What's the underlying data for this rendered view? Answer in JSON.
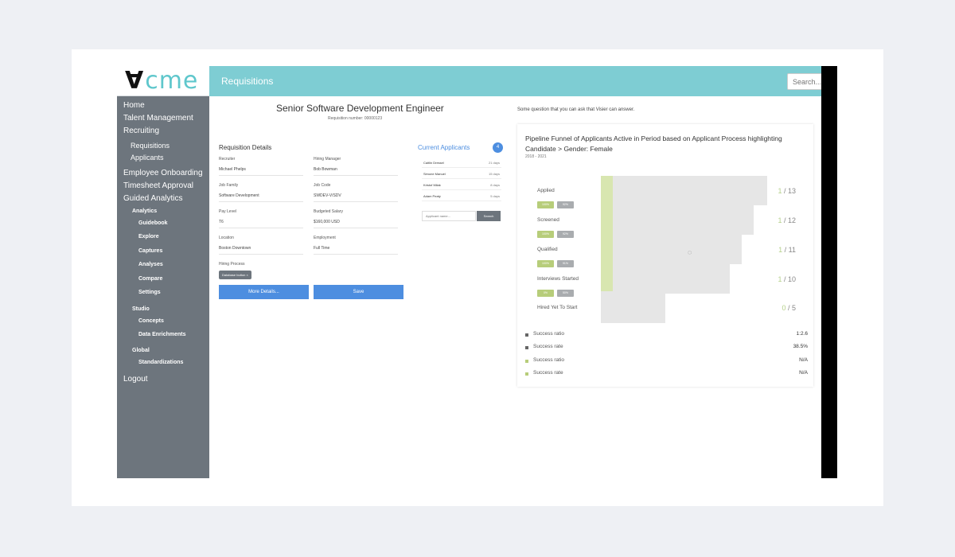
{
  "app": {
    "logo": {
      "mark": "∀",
      "text": "cme"
    },
    "header": {
      "title": "Requisitions",
      "search_placeholder": "Search..."
    }
  },
  "sidebar": {
    "items": [
      {
        "label": "Home",
        "level": 0
      },
      {
        "label": "Talent Management",
        "level": 0
      },
      {
        "label": "Recruiting",
        "level": 0
      },
      {
        "label": "Requisitions",
        "level": 1
      },
      {
        "label": "Applicants",
        "level": 1
      },
      {
        "label": "Employee Onboarding",
        "level": 0
      },
      {
        "label": "Timesheet Approval",
        "level": 0
      },
      {
        "label": "Guided Analytics",
        "level": 0
      },
      {
        "label": "Analytics",
        "level": 2
      },
      {
        "label": "Guidebook",
        "level": 3
      },
      {
        "label": "Explore",
        "level": 3
      },
      {
        "label": "Captures",
        "level": 3
      },
      {
        "label": "Analyses",
        "level": 3
      },
      {
        "label": "Compare",
        "level": 3
      },
      {
        "label": "Settings",
        "level": 3
      },
      {
        "label": "Studio",
        "level": 2
      },
      {
        "label": "Concepts",
        "level": 3
      },
      {
        "label": "Data Enrichments",
        "level": 3
      },
      {
        "label": "Global",
        "level": 2
      },
      {
        "label": "Standardizations",
        "level": 3
      },
      {
        "label": "Logout",
        "level": 0
      }
    ]
  },
  "requisition": {
    "title": "Senior Software Development Engineer",
    "number": "Requisition number: 00000123",
    "details_title": "Requisition Details",
    "fields": {
      "recruiter": {
        "label": "Recruiter",
        "value": "Michael Phelps"
      },
      "hiring_manager": {
        "label": "Hiring Manager",
        "value": "Bob Bowman"
      },
      "job_family": {
        "label": "Job Family",
        "value": "Software Development"
      },
      "job_code": {
        "label": "Job Code",
        "value": "SWDEV-V/SDV"
      },
      "pay_level": {
        "label": "Pay Level",
        "value": "T6"
      },
      "budgeted_salary": {
        "label": "Budgeted Salary",
        "value": "$160,000 USD"
      },
      "location": {
        "label": "Location",
        "value": "Boston Downtown"
      },
      "employment": {
        "label": "Employment",
        "value": "Full Time"
      }
    },
    "hiring_process": {
      "label": "Hiring Process",
      "tag": "Database button  ×"
    },
    "more_details_label": "More Details...",
    "save_label": "Save"
  },
  "current_applicants": {
    "title": "Current Applicants",
    "count": "4",
    "rows": [
      {
        "name": "Caitlin Dressel",
        "days": "21 days"
      },
      {
        "name": "Simone Manuel",
        "days": "15 days"
      },
      {
        "name": "Kristof Milak",
        "days": "8 days"
      },
      {
        "name": "Adam Peaty",
        "days": "5 days"
      }
    ],
    "search_placeholder": "Applicant name...",
    "search_label": "Search"
  },
  "analytics": {
    "question": "Some question that you can ask that Visier can answer.",
    "chart_title": "Pipeline Funnel of Applicants Active in Period based on Applicant Process highlighting Candidate > Gender: Female",
    "chart_subtitle": "2018 - 2021",
    "stages": [
      {
        "label": "Applied",
        "ratio_hl": "1",
        "ratio_rest": " / 13",
        "bar_fraction": 0.79,
        "pill_green": "100%",
        "pill_gray": "92%"
      },
      {
        "label": "Screened",
        "ratio_hl": "1",
        "ratio_rest": " / 12",
        "bar_fraction": 0.726,
        "pill_green": "100%",
        "pill_gray": "92%"
      },
      {
        "label": "Qualified",
        "ratio_hl": "1",
        "ratio_rest": " / 11",
        "bar_fraction": 0.668,
        "pill_green": "100%",
        "pill_gray": "91%"
      },
      {
        "label": "Interviews Started",
        "ratio_hl": "1",
        "ratio_rest": " / 10",
        "bar_fraction": 0.61,
        "pill_green": "0%",
        "pill_gray": "50%"
      },
      {
        "label": "Hired Yet To Start",
        "ratio_hl": "0",
        "ratio_rest": " / 5",
        "bar_fraction": 0.304,
        "pill_green": "",
        "pill_gray": ""
      }
    ],
    "legend": [
      {
        "label": "Success ratio",
        "value": "1:2.6",
        "color": "#666666"
      },
      {
        "label": "Success rate",
        "value": "38.5%",
        "color": "#666666"
      },
      {
        "label": "Success ratio",
        "value": "N/A",
        "color": "#b7cd7a"
      },
      {
        "label": "Success rate",
        "value": "N/A",
        "color": "#b7cd7a"
      }
    ]
  }
}
